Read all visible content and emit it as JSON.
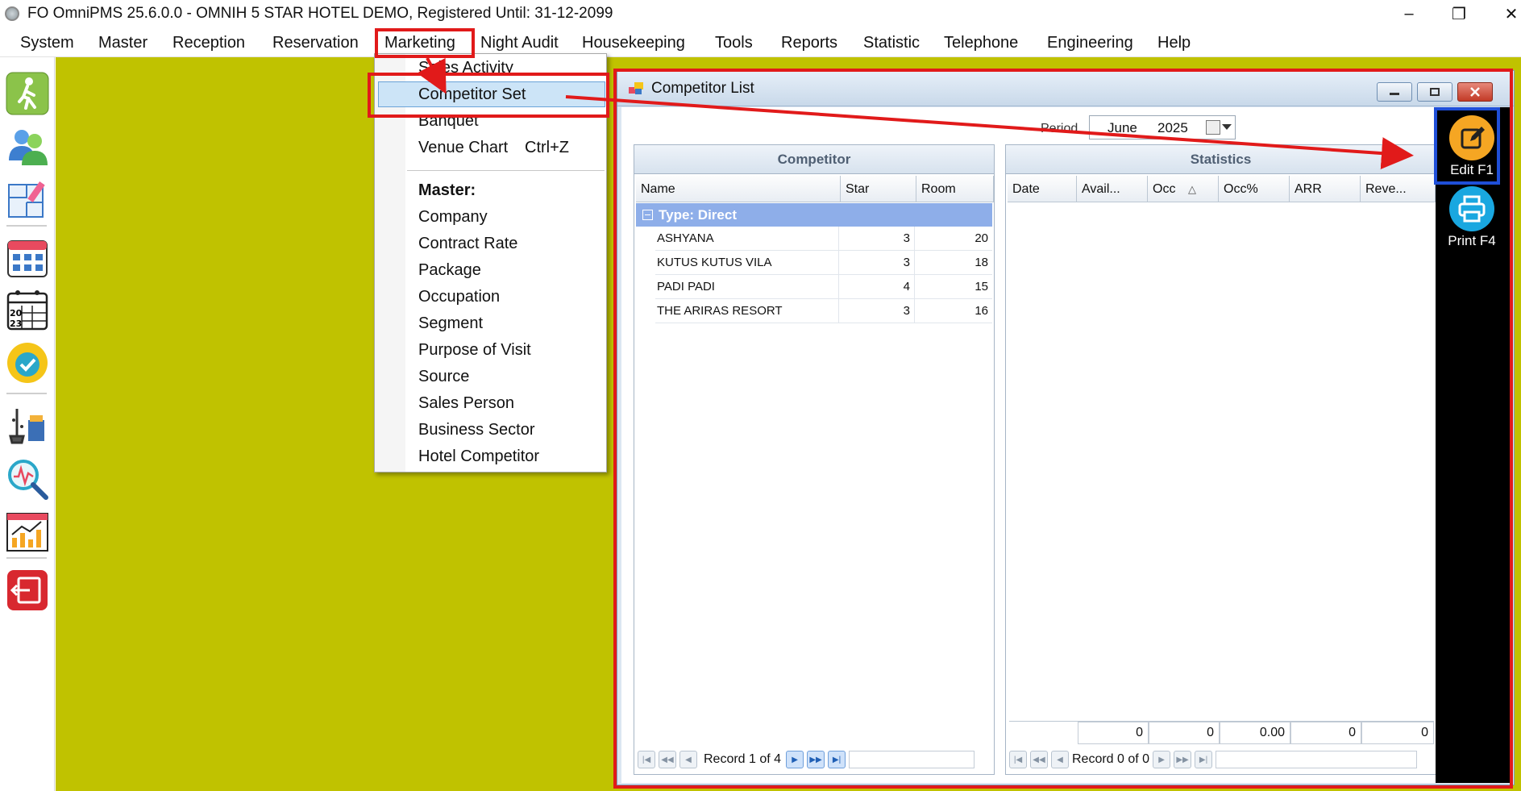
{
  "window": {
    "title": "FO OmniPMS 25.6.0.0 - OMNIH 5 STAR HOTEL DEMO, Registered Until: 31-12-2099",
    "minimize_glyph": "–",
    "restore_glyph": "❐",
    "close_glyph": "✕"
  },
  "menubar": [
    {
      "label": "System"
    },
    {
      "label": "Master"
    },
    {
      "label": "Reception"
    },
    {
      "label": "Reservation"
    },
    {
      "label": "Marketing"
    },
    {
      "label": "Night Audit"
    },
    {
      "label": "Housekeeping"
    },
    {
      "label": "Tools"
    },
    {
      "label": "Reports"
    },
    {
      "label": "Statistic"
    },
    {
      "label": "Telephone"
    },
    {
      "label": "Engineering"
    },
    {
      "label": "Help"
    }
  ],
  "marketing_menu": {
    "items": [
      {
        "label": "Sales Activity"
      },
      {
        "label": "Competitor Set"
      },
      {
        "label": "Banquet"
      },
      {
        "label": "Venue Chart",
        "shortcut": "Ctrl+Z"
      }
    ],
    "master_header": "Master:",
    "master_items": [
      {
        "label": "Company"
      },
      {
        "label": "Contract Rate"
      },
      {
        "label": "Package"
      },
      {
        "label": "Occupation"
      },
      {
        "label": "Segment"
      },
      {
        "label": "Purpose of Visit"
      },
      {
        "label": "Source"
      },
      {
        "label": "Sales Person"
      },
      {
        "label": "Business Sector"
      },
      {
        "label": "Hotel Competitor"
      }
    ]
  },
  "competitor_window": {
    "title": "Competitor List",
    "period_label": "Period",
    "period_month": "June",
    "period_year": "2025",
    "competitor_grid": {
      "header": "Competitor",
      "columns": [
        "Name",
        "Star",
        "Room"
      ],
      "group_label": "Type: Direct",
      "rows": [
        {
          "name": "ASHYANA",
          "star": "3",
          "room": "20"
        },
        {
          "name": "KUTUS KUTUS VILA",
          "star": "3",
          "room": "18"
        },
        {
          "name": "PADI PADI",
          "star": "4",
          "room": "15"
        },
        {
          "name": "THE ARIRAS RESORT",
          "star": "3",
          "room": "16"
        }
      ],
      "record_text": "Record 1 of 4"
    },
    "statistics_grid": {
      "header": "Statistics",
      "columns": [
        "Date",
        "Avail...",
        "Occ",
        "Occ%",
        "ARR",
        "Reve..."
      ],
      "sort_glyph": "△",
      "footer_values": [
        "0",
        "0",
        "0.00",
        "0",
        "0"
      ],
      "record_text": "Record 0 of 0"
    }
  },
  "action_buttons": [
    {
      "label": "Edit F1",
      "color": "#f5a623",
      "icon": "edit-icon"
    },
    {
      "label": "Print F4",
      "color": "#19a7e0",
      "icon": "printer-icon"
    }
  ],
  "sidebar_icons": [
    "walk-icon",
    "users-icon",
    "floor-plan-icon",
    "calendar-grid-icon",
    "calendar-2023-icon",
    "available-badge-icon",
    "housekeeping-icon",
    "analytics-search-icon",
    "chart-icon",
    "exit-icon"
  ],
  "colors": {
    "workspace_bg": "#c0c200",
    "annotation_red": "#e11a1a",
    "annotation_blue": "#1f4fd8",
    "group_row": "#8eaee9",
    "menu_highlight": "#cce4f7"
  }
}
